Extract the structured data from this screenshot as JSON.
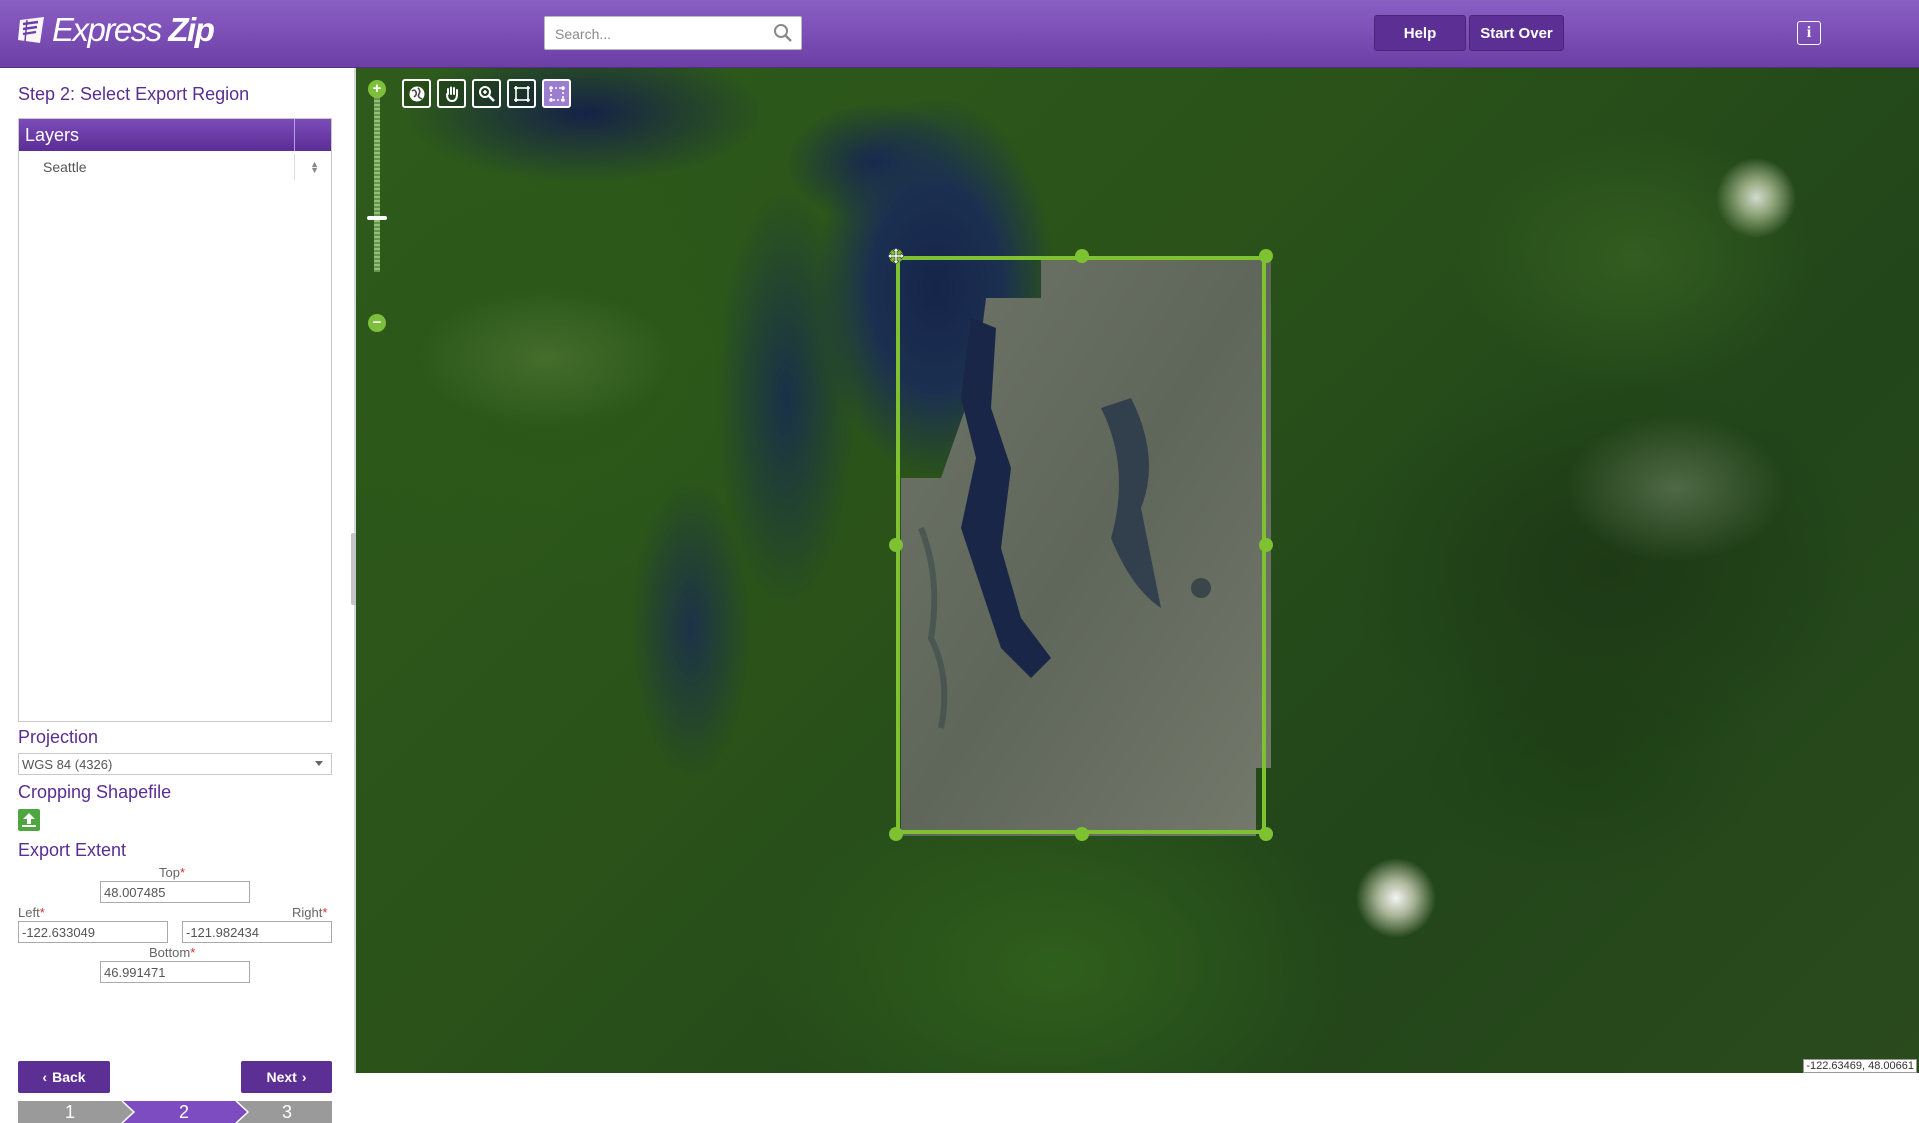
{
  "header": {
    "logo_text_1": "Express",
    "logo_text_2": "Zip",
    "search_placeholder": "Search...",
    "help_label": "Help",
    "start_over_label": "Start Over"
  },
  "sidebar": {
    "step_title": "Step 2: Select Export Region",
    "layers_header": "Layers",
    "layers": [
      {
        "name": "Seattle"
      }
    ],
    "projection_title": "Projection",
    "projection_value": "WGS 84 (4326)",
    "shapefile_title": "Cropping Shapefile",
    "extent_title": "Export Extent",
    "top_label": "Top",
    "left_label": "Left",
    "right_label": "Right",
    "bottom_label": "Bottom",
    "required_mark": "*",
    "top_value": "48.007485",
    "left_value": "-122.633049",
    "right_value": "-121.982434",
    "bottom_value": "46.991471",
    "back_label": "Back",
    "next_label": "Next",
    "steps": [
      "1",
      "2",
      "3"
    ],
    "active_step": 2
  },
  "map": {
    "tools": [
      "globe-icon",
      "pan-hand-icon",
      "zoom-icon",
      "box-select-icon",
      "edit-box-icon"
    ],
    "active_tool": "edit-box-icon",
    "coordinate_readout": "-122.63469, 48.00661"
  },
  "colors": {
    "brand_purple": "#6d3fa6",
    "button_purple": "#5b2f94",
    "selection_green": "#7ec232"
  }
}
